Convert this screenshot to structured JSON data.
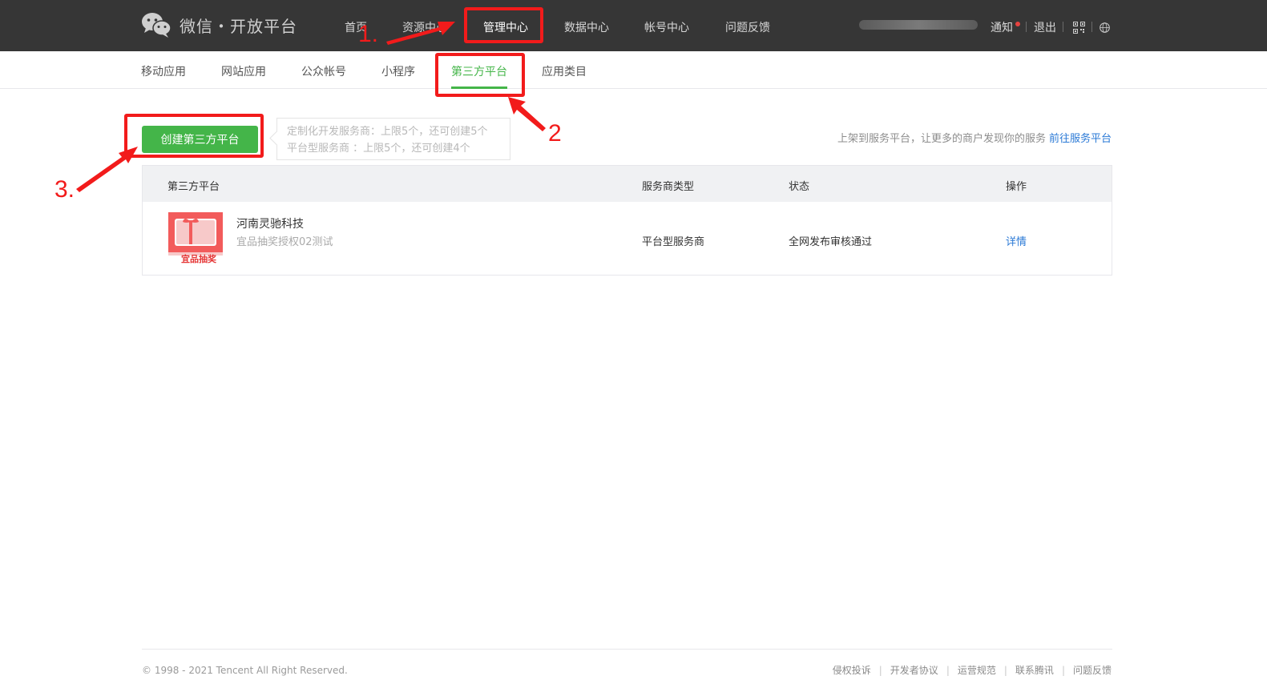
{
  "header": {
    "brand": "微信・开放平台",
    "nav": [
      "首页",
      "资源中心",
      "管理中心",
      "数据中心",
      "帐号中心",
      "问题反馈"
    ],
    "active_nav": "管理中心",
    "notice": "通知",
    "logout": "退出",
    "qrcode_icon": "qrcode-icon",
    "language_icon": "globe-icon"
  },
  "subnav": {
    "items": [
      "移动应用",
      "网站应用",
      "公众帐号",
      "小程序",
      "第三方平台",
      "应用类目"
    ],
    "active": "第三方平台"
  },
  "actions": {
    "create_button": "创建第三方平台",
    "tip_line1": "定制化开发服务商：上限5个，还可创建5个",
    "tip_line2": "平台型服务商 ：上限5个，还可创建4个",
    "promo_text": "上架到服务平台，让更多的商户发现你的服务",
    "promo_link": "前往服务平台"
  },
  "table": {
    "headers": [
      "第三方平台",
      "服务商类型",
      "状态",
      "操作"
    ],
    "rows": [
      {
        "name": "河南灵驰科技",
        "desc": "宜品抽奖授权02测试",
        "icon_text": "宜品抽奖",
        "type": "平台型服务商",
        "status": "全网发布审核通过",
        "action": "详情"
      }
    ]
  },
  "footer": {
    "copyright": "© 1998 - 2021 Tencent All Right Reserved.",
    "links": [
      "侵权投诉",
      "开发者协议",
      "运营规范",
      "联系腾讯",
      "问题反馈"
    ]
  },
  "annotations": {
    "step1": "1.",
    "step2": "2",
    "step3": "3.",
    "color": "#f21b1b"
  },
  "colors": {
    "topbar": "#363636",
    "accent_green": "#44b549",
    "link_blue": "#2a79d6"
  }
}
